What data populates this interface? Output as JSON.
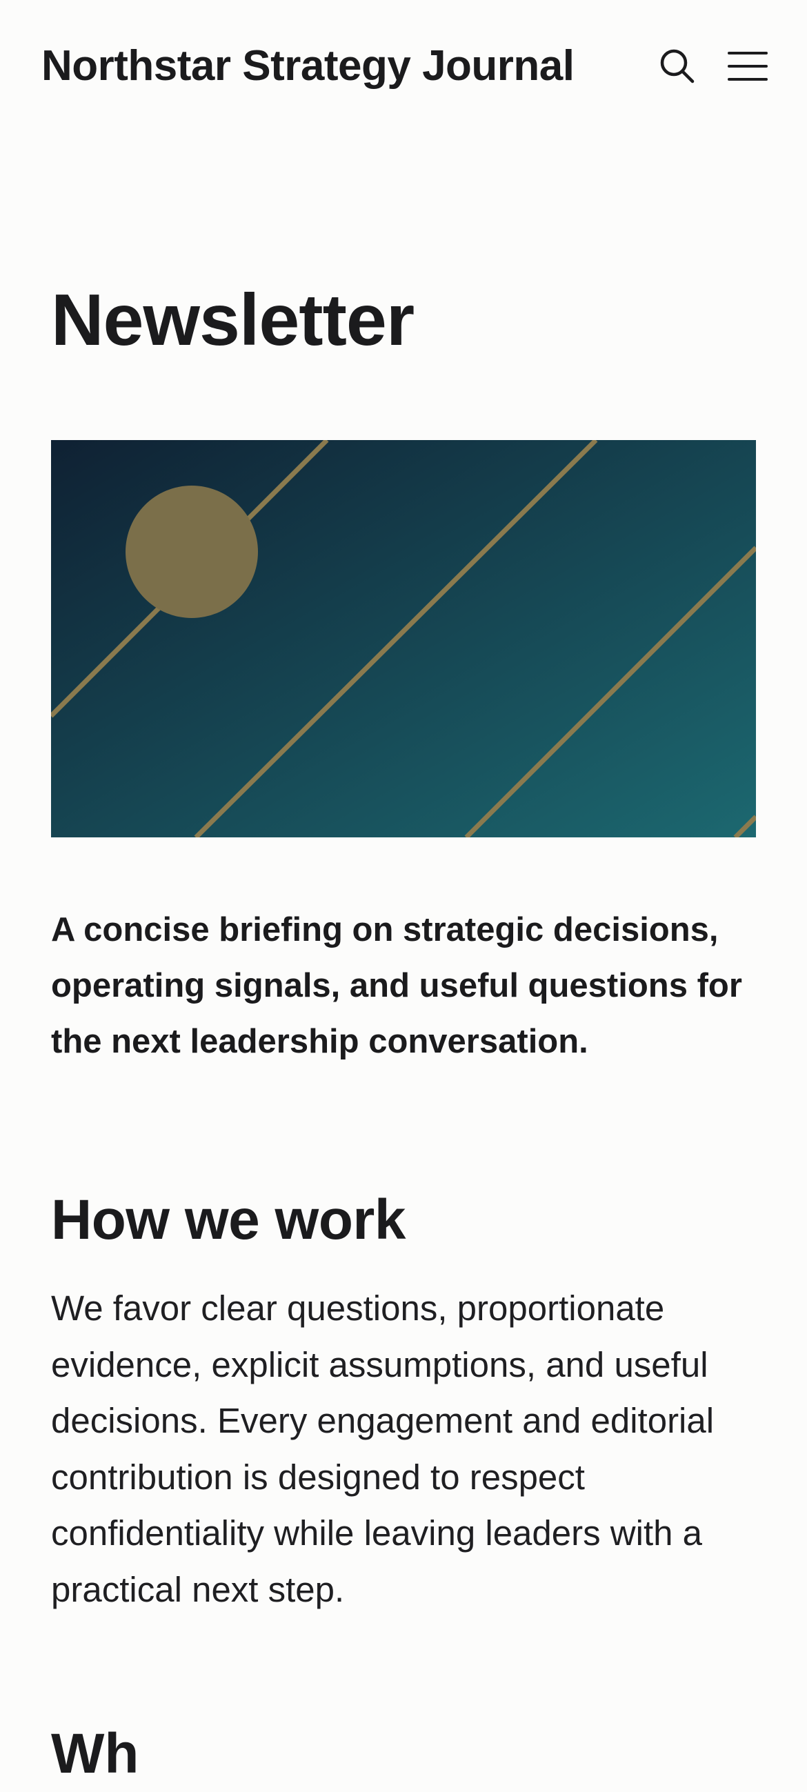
{
  "header": {
    "site_title": "Northstar Strategy Journal",
    "search_icon": "search-icon",
    "menu_icon": "hamburger-menu-icon"
  },
  "page": {
    "title": "Newsletter"
  },
  "hero": {
    "colors": {
      "gradient_start": "#0f2133",
      "gradient_end": "#1c6870",
      "accent_gold": "#8a7a4e",
      "circle": "#7b6f4a"
    }
  },
  "intro": {
    "lede": "A concise briefing on strategic decisions, operating signals, and useful questions for the next leadership conversation."
  },
  "how_we_work": {
    "heading": "How we work",
    "body": "We favor clear questions, proportionate evidence, explicit assumptions, and useful decisions. Every engagement and editorial contribution is designed to respect confidentiality while leaving leaders with a practical next step."
  },
  "next_section": {
    "heading": "Wh"
  }
}
